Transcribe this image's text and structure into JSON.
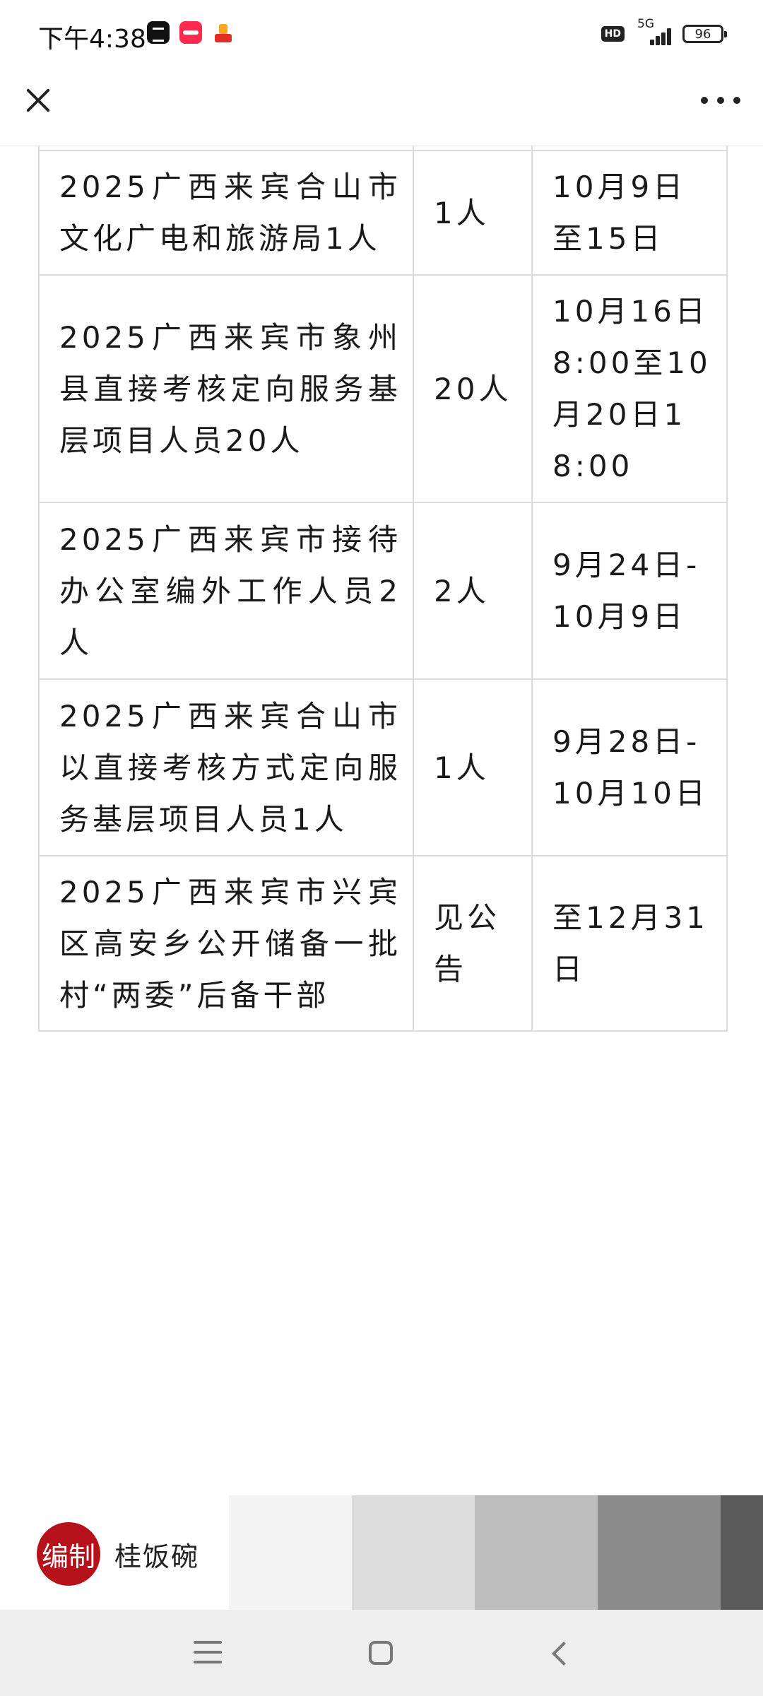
{
  "status_bar": {
    "time": "下午4:38",
    "hd": "HD",
    "network": "5G",
    "battery": "96",
    "app_icons": [
      "capcut-icon",
      "red-app-icon",
      "pinduoduo-icon"
    ]
  },
  "nav": {
    "close_icon": "close-icon",
    "more_icon": "more-dots-icon"
  },
  "table": {
    "rows": [
      {
        "title": "2025广西来宾合山市文化广电和旅游局1人",
        "count": "1人",
        "date": "10月9日至15日"
      },
      {
        "title": "2025广西来宾市象州县直接考核定向服务基层项目人员20人",
        "count": "20人",
        "date": "10月16日8:00至10月20日18:00"
      },
      {
        "title": "2025广西来宾市接待办公室编外工作人员2人",
        "count": "2人",
        "date": "9月24日-10月9日"
      },
      {
        "title": "2025广西来宾合山市以直接考核方式定向服务基层项目人员1人",
        "count": "1人",
        "date": "9月28日-10月10日"
      },
      {
        "title": "2025广西来宾市兴宾区高安乡公开储备一批村“两委”后备干部",
        "count": "见公告",
        "date": "至12月31日"
      }
    ]
  },
  "banner": {
    "seal_text": "编制",
    "brand_name": "桂饭碗",
    "swatch_colors": [
      "#f4f4f4",
      "#dcdcdc",
      "#bdbdbd",
      "#8c8c8c",
      "#5a5a5a"
    ]
  },
  "navbar": {
    "menu_icon": "menu-icon",
    "home_icon": "home-icon",
    "back_icon": "back-icon"
  }
}
